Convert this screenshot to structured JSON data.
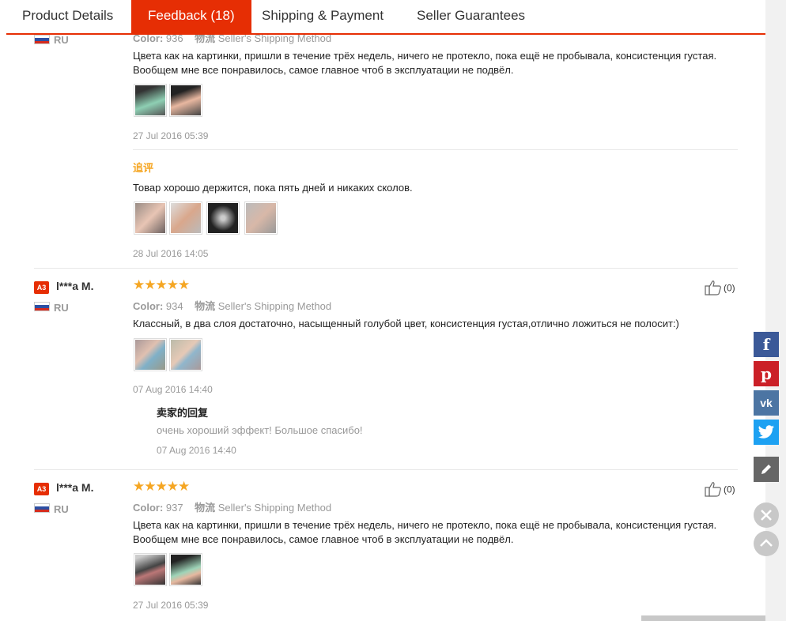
{
  "tabs": [
    {
      "label": "Product Details"
    },
    {
      "label": "Feedback (18)"
    },
    {
      "label": "Shipping & Payment"
    },
    {
      "label": "Seller Guarantees"
    }
  ],
  "colors": {
    "accent": "#e62e04",
    "star": "#f5a623",
    "facebook": "#3b5998",
    "pinterest": "#cb2027",
    "vk": "#4c75a3",
    "twitter": "#1da1f2"
  },
  "review0": {
    "country": "RU",
    "color_label": "Color:",
    "color_value": "936",
    "logistics_label": "物流",
    "logistics_value": "Seller's Shipping Method",
    "text": "Цвета как на картинки, пришли в течение трёх недель, ничего не протекло, пока ещё не пробывала, консистенция густая. Вообщем мне все понравилось, самое главное чтоб в эксплуатации не подвёл.",
    "date": "27 Jul 2016 05:39",
    "additional_label": "追评",
    "additional_text": "Товар хорошо держится, пока пять дней и никаких сколов.",
    "additional_date": "28 Jul 2016 14:05"
  },
  "review1": {
    "badge": "A3",
    "user": "l***a M.",
    "country": "RU",
    "stars": "★★★★★",
    "helpful": "(0)",
    "color_label": "Color:",
    "color_value": "934",
    "logistics_label": "物流",
    "logistics_value": "Seller's Shipping Method",
    "text": "Классный, в два слоя достаточно, насыщенный голубой цвет, консистенция густая,отлично ложиться не полосит:)",
    "date": "07 Aug 2016 14:40",
    "reply_title": "卖家的回复",
    "reply_text": "очень хороший эффект! Большое спасибо!",
    "reply_date": "07 Aug 2016 14:40"
  },
  "review2": {
    "badge": "A3",
    "user": "l***a M.",
    "country": "RU",
    "stars": "★★★★★",
    "helpful": "(0)",
    "color_label": "Color:",
    "color_value": "937",
    "logistics_label": "物流",
    "logistics_value": "Seller's Shipping Method",
    "text": "Цвета как на картинки, пришли в течение трёх недель, ничего не протекло, пока ещё не пробывала, консистенция густая. Вообщем мне все понравилось, самое главное чтоб в эксплуатации не подвёл.",
    "date": "27 Jul 2016 05:39"
  },
  "share": {
    "facebook": "facebook-icon",
    "pinterest": "pinterest-icon",
    "vk": "vk-icon",
    "twitter": "twitter-icon",
    "edit": "edit-icon",
    "close": "close-icon",
    "top": "back-to-top-icon"
  }
}
